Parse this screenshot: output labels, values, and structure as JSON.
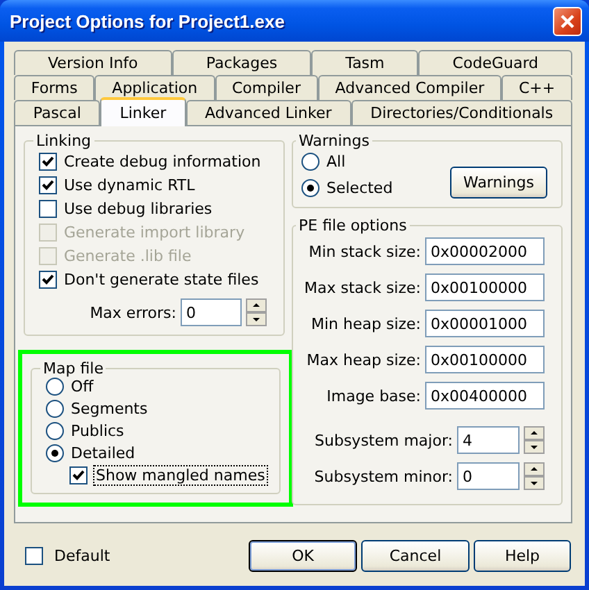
{
  "window": {
    "title": "Project Options for Project1.exe"
  },
  "tab_rows": [
    [
      {
        "label": "Version Info",
        "selected": false
      },
      {
        "label": "Packages",
        "selected": false
      },
      {
        "label": "Tasm",
        "selected": false
      },
      {
        "label": "CodeGuard",
        "selected": false
      }
    ],
    [
      {
        "label": "Forms",
        "selected": false
      },
      {
        "label": "Application",
        "selected": false
      },
      {
        "label": "Compiler",
        "selected": false
      },
      {
        "label": "Advanced Compiler",
        "selected": false
      },
      {
        "label": "C++",
        "selected": false
      }
    ],
    [
      {
        "label": "Pascal",
        "selected": false
      },
      {
        "label": "Linker",
        "selected": true
      },
      {
        "label": "Advanced Linker",
        "selected": false
      },
      {
        "label": "Directories/Conditionals",
        "selected": false
      }
    ]
  ],
  "linking": {
    "title": "Linking",
    "options": [
      {
        "label": "Create debug information",
        "checked": true,
        "disabled": false
      },
      {
        "label": "Use dynamic RTL",
        "checked": true,
        "disabled": false
      },
      {
        "label": "Use debug libraries",
        "checked": false,
        "disabled": false
      },
      {
        "label": "Generate import library",
        "checked": false,
        "disabled": true
      },
      {
        "label": "Generate .lib file",
        "checked": false,
        "disabled": true
      },
      {
        "label": "Don't generate state files",
        "checked": true,
        "disabled": false
      }
    ],
    "max_errors": {
      "label": "Max errors:",
      "value": "0"
    }
  },
  "map_file": {
    "title": "Map file",
    "highlighted": true,
    "options": [
      {
        "label": "Off",
        "selected": false
      },
      {
        "label": "Segments",
        "selected": false
      },
      {
        "label": "Publics",
        "selected": false
      },
      {
        "label": "Detailed",
        "selected": true
      }
    ],
    "show_mangled": {
      "label": "Show mangled names",
      "checked": true,
      "focused": true
    }
  },
  "warnings": {
    "title": "Warnings",
    "options": [
      {
        "label": "All",
        "selected": false
      },
      {
        "label": "Selected",
        "selected": true
      }
    ],
    "button": "Warnings"
  },
  "pe_file_options": {
    "title": "PE file options",
    "fields": [
      {
        "label": "Min stack size:",
        "value": "0x00002000",
        "kind": "text"
      },
      {
        "label": "Max stack size:",
        "value": "0x00100000",
        "kind": "text"
      },
      {
        "label": "Min heap size:",
        "value": "0x00001000",
        "kind": "text"
      },
      {
        "label": "Max heap size:",
        "value": "0x00100000",
        "kind": "text"
      },
      {
        "label": "Image base:",
        "value": "0x00400000",
        "kind": "text"
      },
      {
        "label": "Subsystem major:",
        "value": "4",
        "kind": "spin"
      },
      {
        "label": "Subsystem minor:",
        "value": "0",
        "kind": "spin"
      }
    ]
  },
  "default": {
    "label": "Default",
    "checked": false
  },
  "buttons": [
    {
      "label": "OK",
      "default": true
    },
    {
      "label": "Cancel",
      "default": false
    },
    {
      "label": "Help",
      "default": false
    }
  ]
}
